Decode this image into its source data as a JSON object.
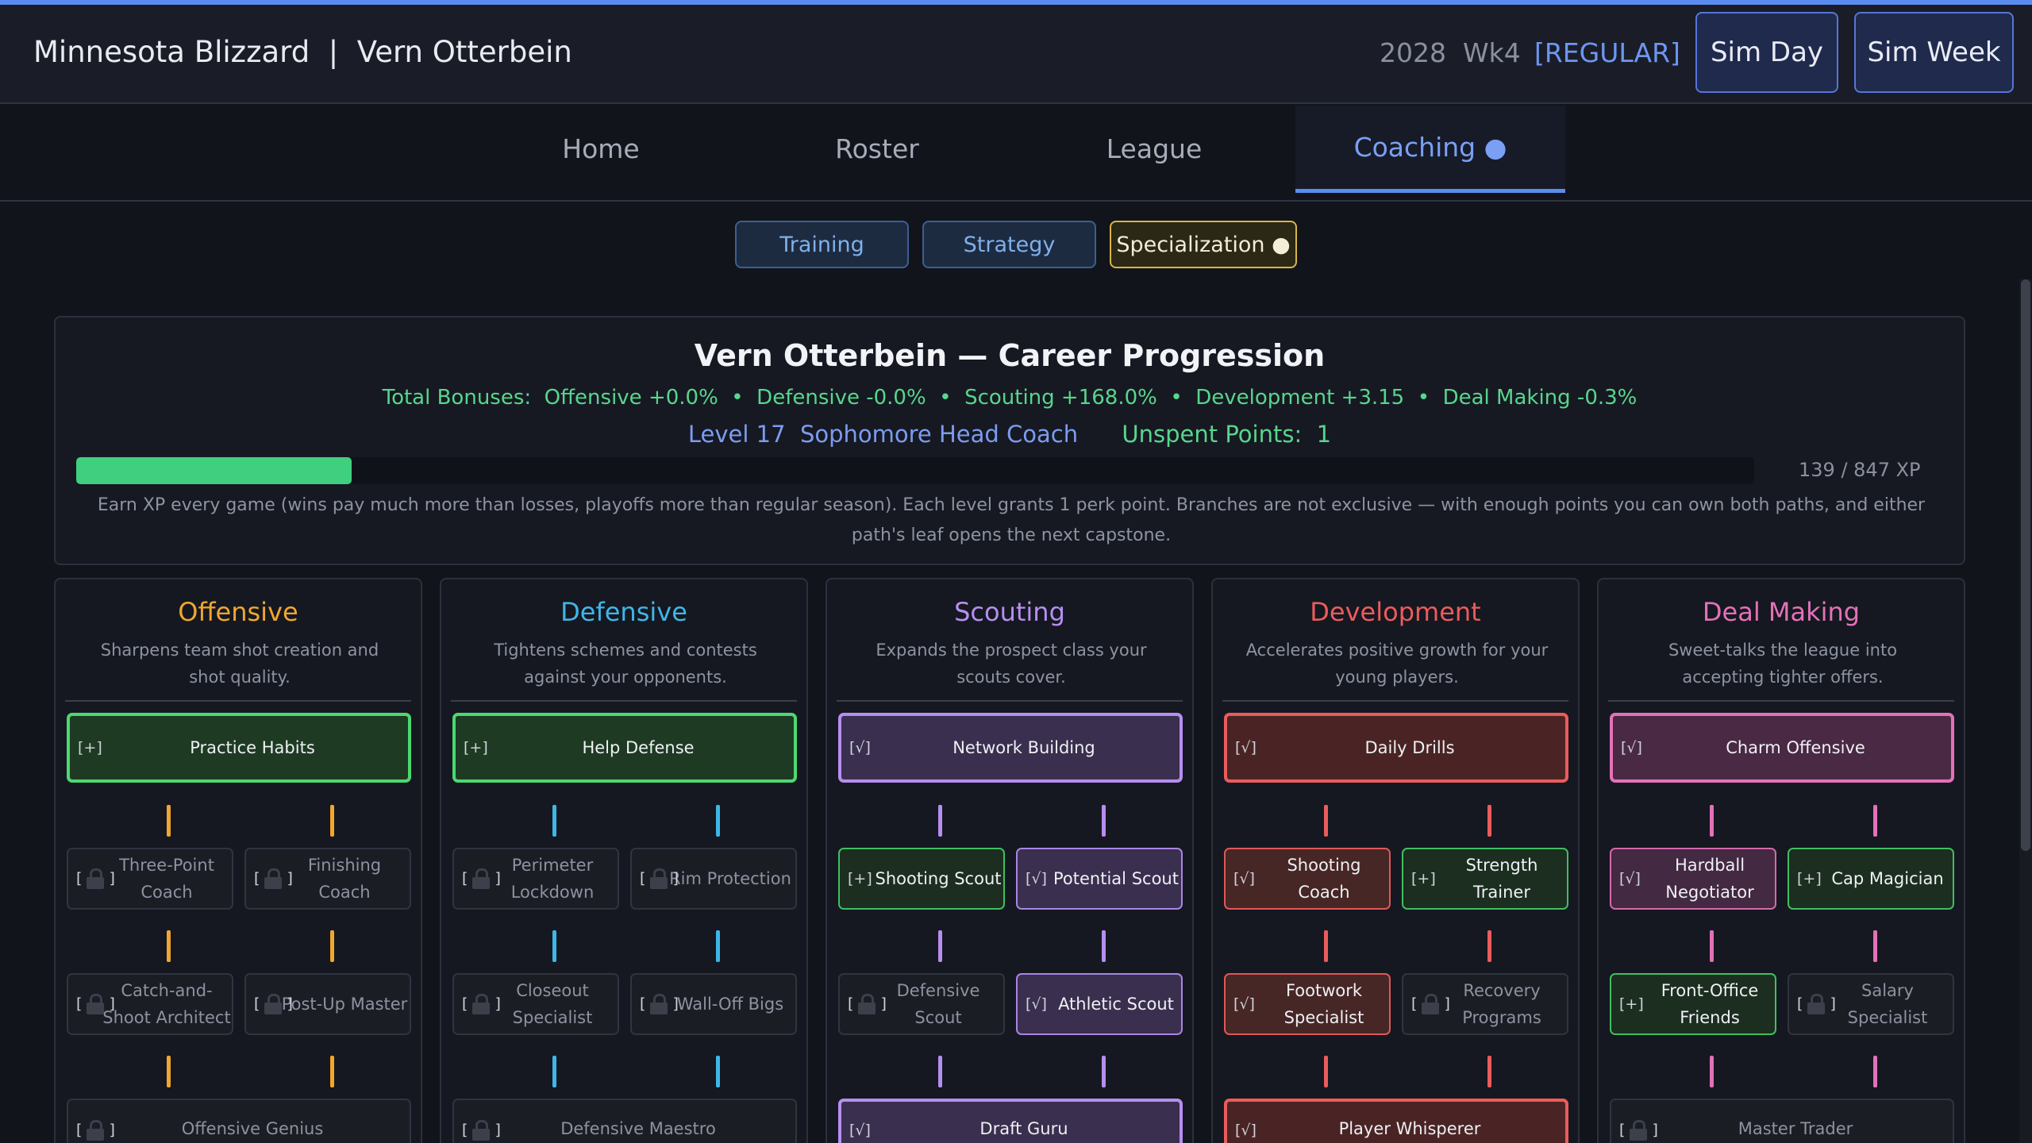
{
  "header": {
    "team": "Minnesota Blizzard",
    "separator": "|",
    "coach": "Vern Otterbein",
    "year": "2028",
    "week": "Wk4",
    "phase": "[REGULAR]",
    "sim_day": "Sim Day",
    "sim_week": "Sim Week"
  },
  "nav": {
    "tabs": [
      {
        "label": "Home"
      },
      {
        "label": "Roster"
      },
      {
        "label": "League"
      },
      {
        "label": "Coaching ●"
      }
    ],
    "active": "Coaching"
  },
  "subtabs": [
    {
      "label": "Training"
    },
    {
      "label": "Strategy"
    },
    {
      "label": "Specialization ●"
    }
  ],
  "progression": {
    "title": "Vern Otterbein — Career Progression",
    "bonuses": "Total Bonuses:  Offensive +0.0%  •  Defensive -0.0%  •  Scouting +168.0%  •  Development +3.15  •  Deal Making -0.3%",
    "level": "Level 17  Sophomore Head Coach",
    "unspent": "Unspent Points:  1",
    "xp_text": "139 / 847 XP",
    "xp_fraction": 0.164,
    "note": "Earn XP every game (wins pay much more than losses, playoffs more than regular season). Each level grants 1 perk point. Branches are not exclusive — with enough points you can own both paths, and either path's leaf opens the next capstone."
  },
  "columns": [
    {
      "title": "Offensive",
      "color": "#f0a62f",
      "desc": "Sharpens team shot creation and shot quality.",
      "top": {
        "mark": "[+]",
        "label": "Practice Habits"
      },
      "row1": [
        {
          "mark": "[",
          "label": "Three-Point Coach"
        },
        {
          "mark": "[",
          "label": "Finishing Coach"
        }
      ],
      "row2": [
        {
          "mark": "[",
          "label": "Catch-and-Shoot Architect"
        },
        {
          "mark": "[",
          "label": "Post-Up Master"
        }
      ],
      "cap": {
        "mark": "[",
        "label": "Offensive Genius"
      }
    },
    {
      "title": "Defensive",
      "color": "#3fb6e8",
      "desc": "Tightens schemes and contests against your opponents.",
      "top": {
        "mark": "[+]",
        "label": "Help Defense"
      },
      "row1": [
        {
          "mark": "[",
          "label": "Perimeter Lockdown"
        },
        {
          "mark": "[",
          "label": "Rim Protection"
        }
      ],
      "row2": [
        {
          "mark": "[",
          "label": "Closeout Specialist"
        },
        {
          "mark": "[",
          "label": "Wall-Off Bigs"
        }
      ],
      "cap": {
        "mark": "[",
        "label": "Defensive Maestro"
      }
    },
    {
      "title": "Scouting",
      "color": "#b68ef0",
      "desc": "Expands the prospect class your scouts cover.",
      "top": {
        "mark": "[√]",
        "label": "Network Building"
      },
      "row1": [
        {
          "mark": "[+]",
          "label": "Shooting Scout"
        },
        {
          "mark": "[√]",
          "label": "Potential Scout"
        }
      ],
      "row2": [
        {
          "mark": "[",
          "label": "Defensive Scout"
        },
        {
          "mark": "[√]",
          "label": "Athletic Scout"
        }
      ],
      "cap": {
        "mark": "[√]",
        "label": "Draft Guru"
      }
    },
    {
      "title": "Development",
      "color": "#ea5c5c",
      "desc": "Accelerates positive growth for your young players.",
      "top": {
        "mark": "[√]",
        "label": "Daily Drills"
      },
      "row1": [
        {
          "mark": "[√]",
          "label": "Shooting Coach"
        },
        {
          "mark": "[+]",
          "label": "Strength Trainer"
        }
      ],
      "row2": [
        {
          "mark": "[√]",
          "label": "Footwork Specialist"
        },
        {
          "mark": "[",
          "label": "Recovery Programs"
        }
      ],
      "cap": {
        "mark": "[√]",
        "label": "Player Whisperer"
      }
    },
    {
      "title": "Deal Making",
      "color": "#e471b8",
      "desc": "Sweet-talks the league into accepting tighter offers.",
      "top": {
        "mark": "[√]",
        "label": "Charm Offensive"
      },
      "row1": [
        {
          "mark": "[√]",
          "label": "Hardball Negotiator"
        },
        {
          "mark": "[+]",
          "label": "Cap Magician"
        }
      ],
      "row2": [
        {
          "mark": "[+]",
          "label": "Front-Office Friends"
        },
        {
          "mark": "[",
          "label": "Salary Specialist"
        }
      ],
      "cap": {
        "mark": "[",
        "label": "Master Trader"
      }
    }
  ],
  "lock_close": "]"
}
